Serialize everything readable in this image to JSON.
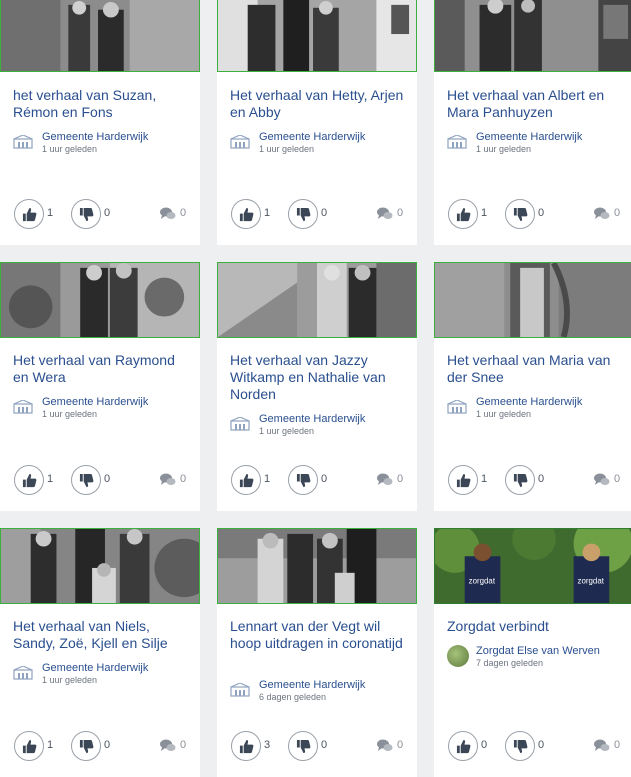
{
  "cards": [
    {
      "title": "het verhaal van Suzan, Rémon en Fons",
      "author": "Gemeente Harderwijk",
      "time": "1 uur geleden",
      "likes": "1",
      "dislikes": "0",
      "comments": "0"
    },
    {
      "title": "Het verhaal van Hetty, Arjen en Abby",
      "author": "Gemeente Harderwijk",
      "time": "1 uur geleden",
      "likes": "1",
      "dislikes": "0",
      "comments": "0"
    },
    {
      "title": "Het verhaal van Albert en Mara Panhuyzen",
      "author": "Gemeente Harderwijk",
      "time": "1 uur geleden",
      "likes": "1",
      "dislikes": "0",
      "comments": "0"
    },
    {
      "title": "Het verhaal van Raymond en Wera",
      "author": "Gemeente Harderwijk",
      "time": "1 uur geleden",
      "likes": "1",
      "dislikes": "0",
      "comments": "0"
    },
    {
      "title": "Het verhaal van Jazzy Witkamp en Nathalie van Norden",
      "author": "Gemeente Harderwijk",
      "time": "1 uur geleden",
      "likes": "1",
      "dislikes": "0",
      "comments": "0"
    },
    {
      "title": "Het verhaal van Maria van der Snee",
      "author": "Gemeente Harderwijk",
      "time": "1 uur geleden",
      "likes": "1",
      "dislikes": "0",
      "comments": "0"
    },
    {
      "title": "Het verhaal van Niels, Sandy, Zoë, Kjell en Silje",
      "author": "Gemeente Harderwijk",
      "time": "1 uur geleden",
      "likes": "1",
      "dislikes": "0",
      "comments": "0"
    },
    {
      "title": "Lennart van der Vegt wil hoop uitdragen in coronatijd",
      "author": "Gemeente Harderwijk",
      "time": "6 dagen geleden",
      "likes": "3",
      "dislikes": "0",
      "comments": "0"
    },
    {
      "title": "Zorgdat verbindt",
      "author": "Zorgdat Else van Werven",
      "time": "7 dagen geleden",
      "likes": "0",
      "dislikes": "0",
      "comments": "0",
      "photo_text": "zorgdat"
    }
  ],
  "icons": {
    "like": "thumbs-up-icon",
    "dislike": "thumbs-down-icon",
    "comment": "comment-bubbles-icon",
    "author_logo": "municipality-logo-icon"
  },
  "colors": {
    "title": "#2a4f8f",
    "photo_border": "#3cb03c",
    "background": "#eeeff1"
  }
}
